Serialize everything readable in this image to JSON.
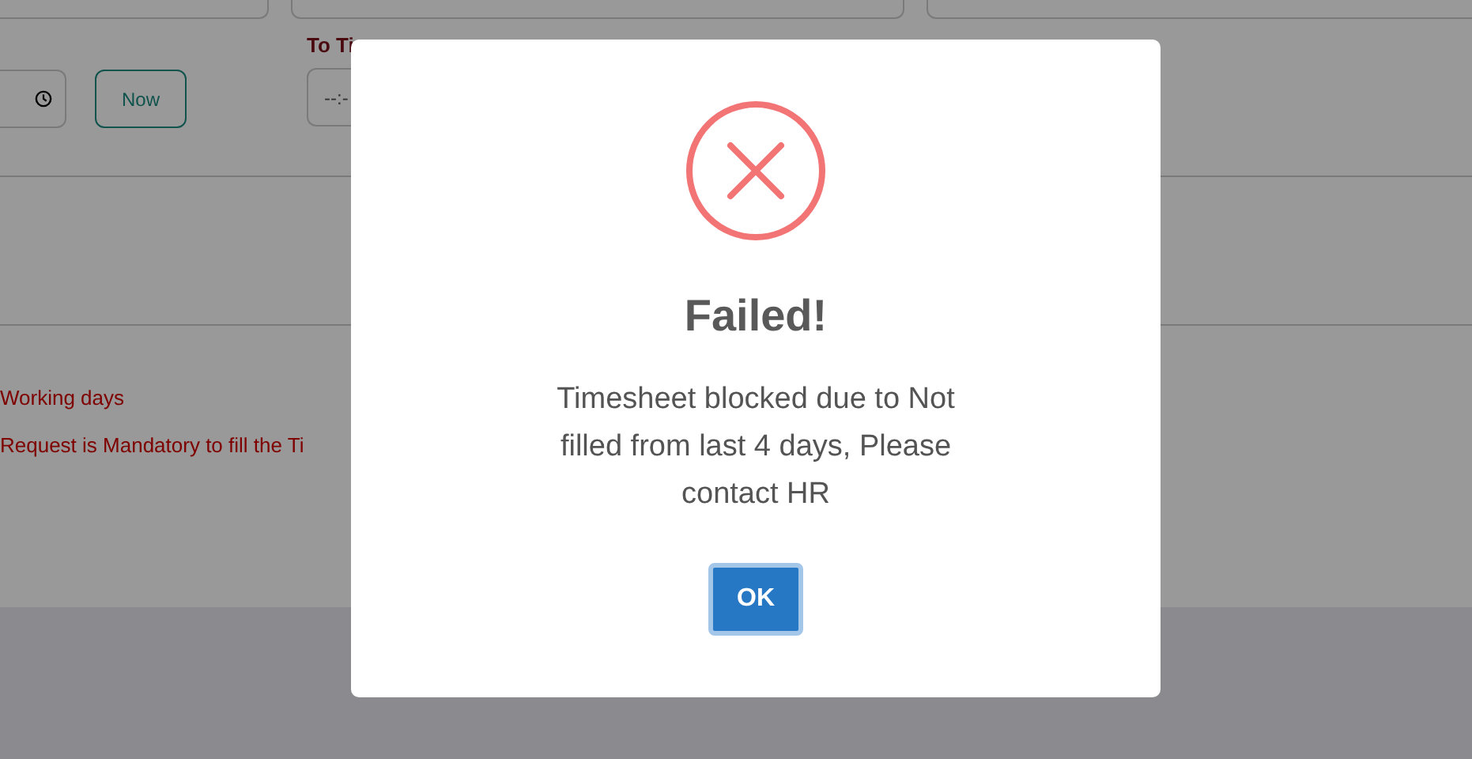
{
  "form": {
    "to_time_label": "To Ti",
    "to_time": {
      "placeholder": "--:-"
    },
    "now_button": "Now",
    "notes": [
      "Working days",
      "Request is Mandatory to fill the Ti"
    ]
  },
  "dialog": {
    "title": "Failed!",
    "message": "Timesheet blocked due to Not filled from last 4 days, Please contact HR",
    "buttons": [
      "OK"
    ]
  }
}
